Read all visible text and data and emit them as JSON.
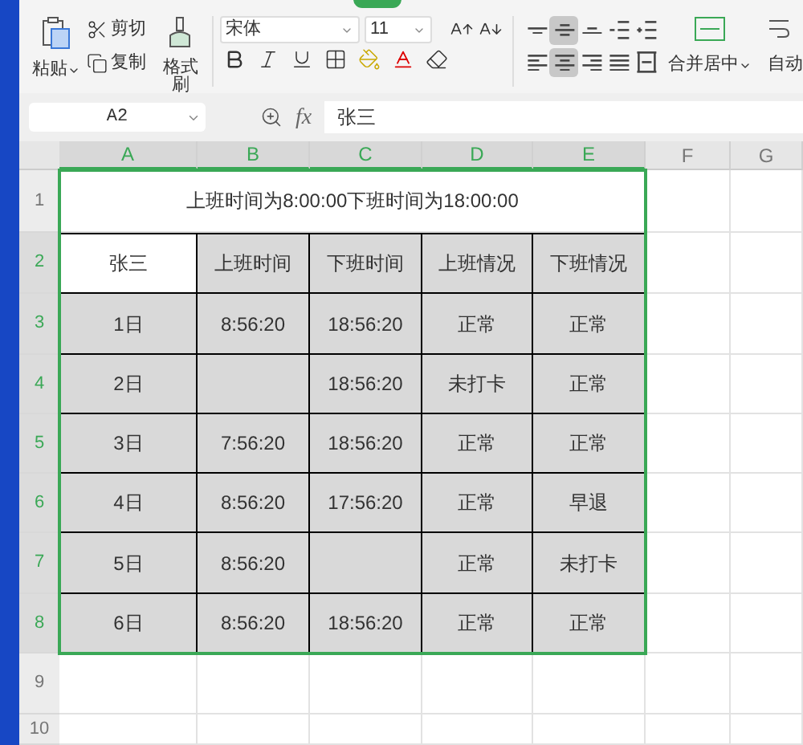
{
  "ribbon": {
    "paste": "粘贴",
    "cut": "剪切",
    "copy": "复制",
    "format_painter": "格式刷",
    "font_name": "宋体",
    "font_size": "11",
    "align_buttons": [
      {
        "kind": "top",
        "selected": false
      },
      {
        "kind": "middle",
        "selected": true
      },
      {
        "kind": "bottom",
        "selected": false
      },
      {
        "kind": "outdent",
        "selected": false
      },
      {
        "kind": "indent",
        "selected": false
      },
      {
        "kind": "left",
        "selected": false
      },
      {
        "kind": "center",
        "selected": true
      },
      {
        "kind": "right",
        "selected": false
      },
      {
        "kind": "justify",
        "selected": false
      },
      {
        "kind": "distribute",
        "selected": false
      }
    ],
    "merge": "合并居中",
    "wrap": "自动"
  },
  "formula_bar": {
    "name_box": "A2",
    "fx": "fx",
    "value": "张三"
  },
  "columns": [
    {
      "label": "A",
      "selected": true
    },
    {
      "label": "B",
      "selected": true
    },
    {
      "label": "C",
      "selected": true
    },
    {
      "label": "D",
      "selected": true
    },
    {
      "label": "E",
      "selected": true
    },
    {
      "label": "F",
      "selected": false
    },
    {
      "label": "G",
      "selected": false
    }
  ],
  "rows": [
    {
      "label": "1",
      "selected": false
    },
    {
      "label": "2",
      "selected": true
    },
    {
      "label": "3",
      "selected": true
    },
    {
      "label": "4",
      "selected": true
    },
    {
      "label": "5",
      "selected": true
    },
    {
      "label": "6",
      "selected": true
    },
    {
      "label": "7",
      "selected": true
    },
    {
      "label": "8",
      "selected": true
    },
    {
      "label": "9",
      "selected": false
    },
    {
      "label": "10",
      "selected": false
    }
  ],
  "title_cell": "上班时间为8:00:00下班时间为18:00:00",
  "table": [
    [
      {
        "text": "张三",
        "shaded": false
      },
      {
        "text": "上班时间",
        "shaded": true
      },
      {
        "text": "下班时间",
        "shaded": true
      },
      {
        "text": "上班情况",
        "shaded": true
      },
      {
        "text": "下班情况",
        "shaded": true
      }
    ],
    [
      {
        "text": "1日",
        "shaded": true
      },
      {
        "text": "8:56:20",
        "shaded": true
      },
      {
        "text": "18:56:20",
        "shaded": true
      },
      {
        "text": "正常",
        "shaded": true
      },
      {
        "text": "正常",
        "shaded": true
      }
    ],
    [
      {
        "text": "2日",
        "shaded": true
      },
      {
        "shaded": true
      },
      {
        "text": "18:56:20",
        "shaded": true
      },
      {
        "text": "未打卡",
        "shaded": true
      },
      {
        "text": "正常",
        "shaded": true
      }
    ],
    [
      {
        "text": "3日",
        "shaded": true
      },
      {
        "text": "7:56:20",
        "shaded": true
      },
      {
        "text": "18:56:20",
        "shaded": true
      },
      {
        "text": "正常",
        "shaded": true
      },
      {
        "text": "正常",
        "shaded": true
      }
    ],
    [
      {
        "text": "4日",
        "shaded": true
      },
      {
        "text": "8:56:20",
        "shaded": true
      },
      {
        "text": "17:56:20",
        "shaded": true
      },
      {
        "text": "正常",
        "shaded": true
      },
      {
        "text": "早退",
        "shaded": true
      }
    ],
    [
      {
        "text": "5日",
        "shaded": true
      },
      {
        "text": "8:56:20",
        "shaded": true
      },
      {
        "shaded": true
      },
      {
        "text": "正常",
        "shaded": true
      },
      {
        "text": "未打卡",
        "shaded": true
      }
    ],
    [
      {
        "text": "6日",
        "shaded": true
      },
      {
        "text": "8:56:20",
        "shaded": true
      },
      {
        "text": "18:56:20",
        "shaded": true
      },
      {
        "text": "正常",
        "shaded": true
      },
      {
        "text": "正常",
        "shaded": true
      }
    ]
  ]
}
